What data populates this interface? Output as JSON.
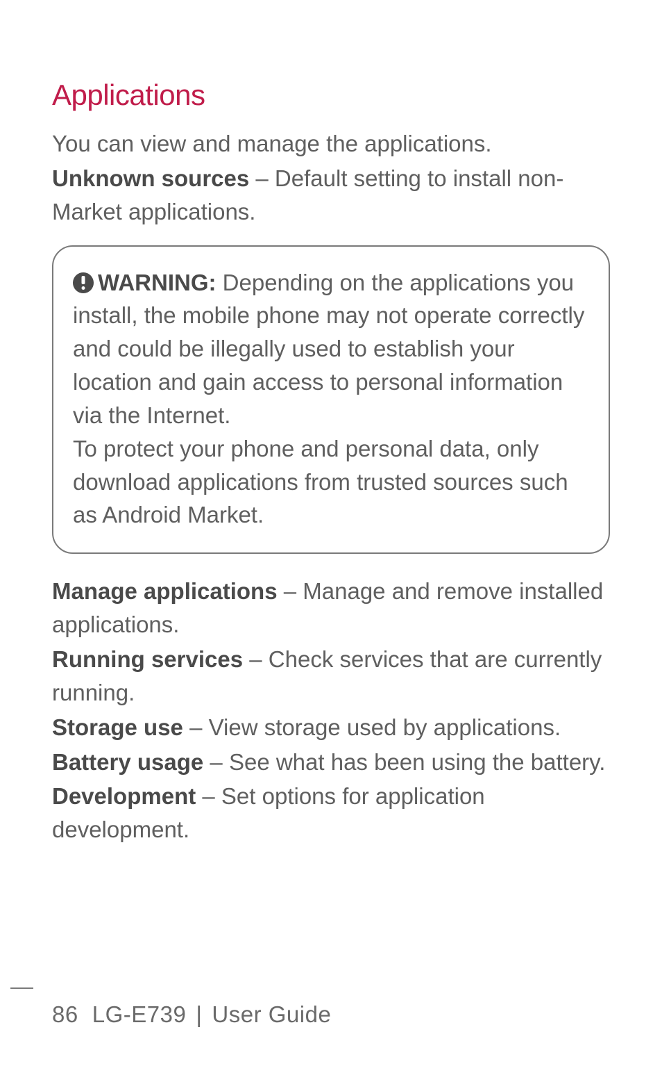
{
  "section_title": "Applications",
  "intro": "You can view and manage the applications.",
  "unknown_sources": {
    "label": "Unknown sources",
    "desc": " – Default setting to install non-Market applications."
  },
  "warning": {
    "label": "WARNING:",
    "para1": " Depending on the applications you install, the mobile phone may not operate correctly and could be illegally used to establish your location and gain access to personal information via the Internet.",
    "para2": "To protect your phone and personal data, only download applications from trusted sources such as Android Market."
  },
  "items": {
    "manage_label": "Manage applications",
    "manage_desc": " – Manage and remove installed applications.",
    "running_label": "Running services",
    "running_desc": " – Check services that are currently running.",
    "storage_label": "Storage use",
    "storage_desc": " – View storage used by applications.",
    "battery_label": "Battery usage",
    "battery_desc": " – See what has been using the battery.",
    "dev_label": "Development",
    "dev_desc": " – Set options for application development."
  },
  "footer": {
    "page": "86",
    "model": "LG-E739",
    "guide": "User Guide"
  }
}
